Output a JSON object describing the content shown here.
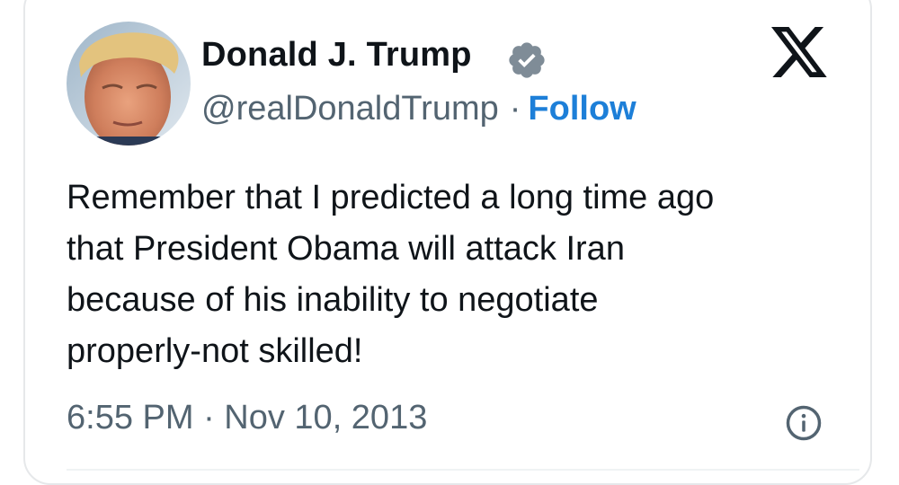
{
  "author": {
    "display_name": "Donald J. Trump",
    "handle": "@realDonaldTrump",
    "separator": "·",
    "follow_label": "Follow",
    "verified_badge": "verified-badge-icon",
    "avatar": "profile-photo"
  },
  "platform_logo": "x-logo",
  "tweet": {
    "text": "Remember that I predicted a long time ago\nthat President Obama will attack Iran\nbecause of his inability to negotiate\nproperly-not skilled!",
    "timestamp": "6:55 PM · Nov 10, 2013"
  },
  "icons": {
    "info": "info-icon"
  },
  "colors": {
    "text_primary": "#0f1419",
    "text_secondary": "#536471",
    "follow_blue": "#1d7fd8",
    "badge_gray": "#7f8c97",
    "card_border": "#e6e8ea"
  }
}
